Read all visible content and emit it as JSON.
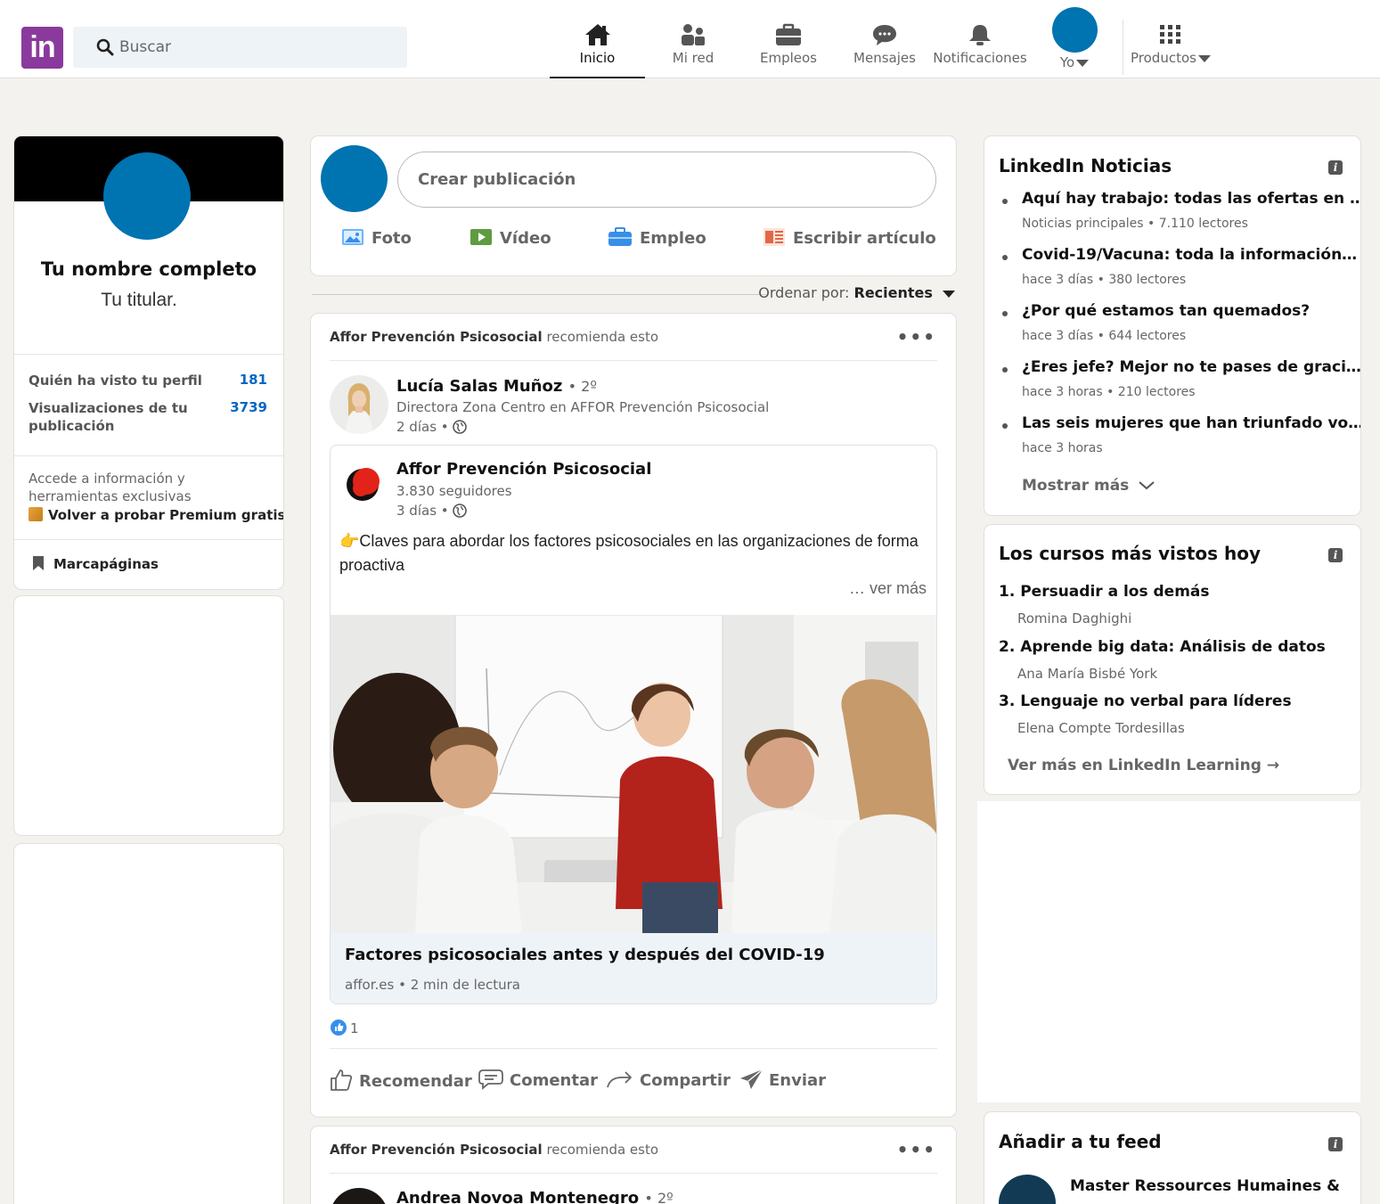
{
  "header": {
    "logo": "in",
    "search_placeholder": "Buscar",
    "nav": [
      {
        "label": "Inicio",
        "icon": "home-icon",
        "active": true
      },
      {
        "label": "Mi red",
        "icon": "network-icon"
      },
      {
        "label": "Empleos",
        "icon": "briefcase-icon"
      },
      {
        "label": "Mensajes",
        "icon": "message-icon"
      },
      {
        "label": "Notificaciones",
        "icon": "bell-icon"
      },
      {
        "label": "Yo",
        "icon": "avatar"
      },
      {
        "label": "Productos",
        "icon": "grid-icon"
      }
    ]
  },
  "profile": {
    "name": "Tu nombre completo",
    "headline": "Tu titular.",
    "stats": [
      {
        "label": "Quién ha visto tu perfil",
        "value": "181"
      },
      {
        "label": "Visualizaciones de tu publicación",
        "value": "3739"
      }
    ],
    "premium_text": "Accede a información y herramientas exclusivas",
    "premium_link": "Volver a probar Premium gratis",
    "bookmarks": "Marcapáginas"
  },
  "compose": {
    "placeholder": "Crear publicación",
    "actions": [
      "Foto",
      "Vídeo",
      "Empleo",
      "Escribir artículo"
    ]
  },
  "sort": {
    "label": "Ordenar por:",
    "value": "Recientes"
  },
  "posts": [
    {
      "recommender": "Affor Prevención Psicosocial",
      "recommend_text": "recomienda esto",
      "author": "Lucía Salas Muñoz",
      "degree": "• 2º",
      "author_title": "Directora Zona Centro en AFFOR Prevención Psicosocial",
      "time": "2 días •",
      "shared": {
        "company": "Affor Prevención Psicosocial",
        "followers": "3.830 seguidores",
        "time": "3 días •",
        "text": "👉Claves para abordar los factores psicosociales en las organizaciones de forma proactiva",
        "see_more": "… ver más",
        "link_title": "Factores psicosociales antes y después del COVID-19",
        "link_meta": "affor.es • 2 min de lectura"
      },
      "reactions": "1",
      "actions": [
        "Recomendar",
        "Comentar",
        "Compartir",
        "Enviar"
      ]
    },
    {
      "recommender": "Affor Prevención Psicosocial",
      "recommend_text": "recomienda esto",
      "author": "Andrea Novoa Montenegro",
      "degree": "• 2º"
    }
  ],
  "news": {
    "title": "LinkedIn Noticias",
    "items": [
      {
        "title": "Aquí hay trabajo: todas las ofertas en …",
        "meta": "Noticias principales • 7.110 lectores"
      },
      {
        "title": "Covid-19/Vacuna: toda la información…",
        "meta": "hace 3 días • 380 lectores"
      },
      {
        "title": "¿Por qué estamos tan quemados?",
        "meta": "hace 3 días • 644 lectores"
      },
      {
        "title": "¿Eres jefe? Mejor no te pases de graci…",
        "meta": "hace 3 horas • 210 lectores"
      },
      {
        "title": "Las seis mujeres que han triunfado vo…",
        "meta": "hace 3 horas"
      }
    ],
    "show_more": "Mostrar más"
  },
  "courses": {
    "title": "Los cursos más vistos hoy",
    "items": [
      {
        "title": "1. Persuadir a los demás",
        "author": "Romina Daghighi"
      },
      {
        "title": "2. Aprende big data: Análisis de datos",
        "author": "Ana María Bisbé York"
      },
      {
        "title": "3. Lenguaje no verbal para líderes",
        "author": "Elena Compte Tordesillas"
      }
    ],
    "more": "Ver más en LinkedIn Learning →"
  },
  "feed_add": {
    "title": "Añadir a tu feed",
    "items": [
      {
        "name": "Master Ressources Humaines &"
      }
    ]
  },
  "colors": {
    "brand": "#8a3a9c",
    "avatar": "#0073b1",
    "link": "#0a66c2",
    "background": "#f3f2ef"
  }
}
